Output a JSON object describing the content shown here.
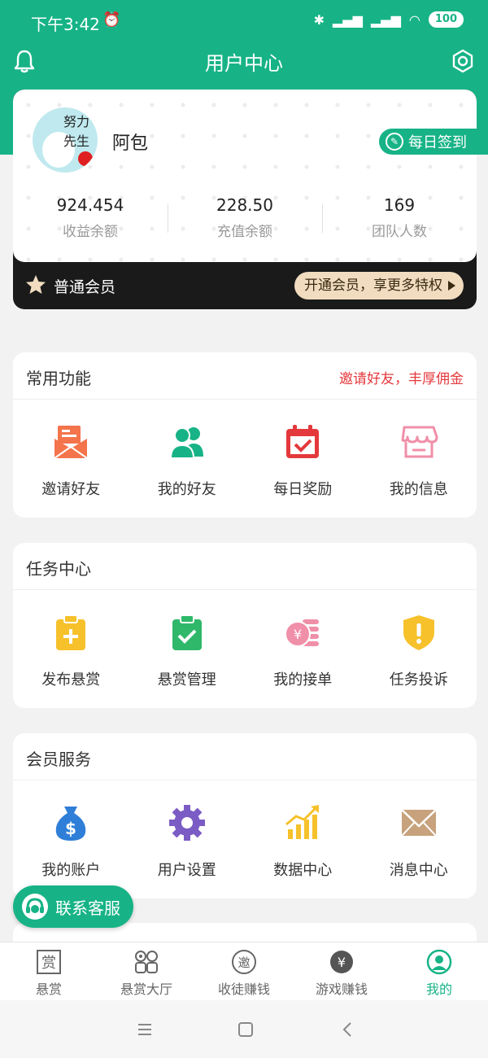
{
  "status": {
    "time": "下午3:42",
    "battery": "100"
  },
  "header": {
    "title": "用户中心"
  },
  "profile": {
    "name": "阿包",
    "avatar_text": "努力先生",
    "checkin_label": "每日签到",
    "stats": [
      {
        "value": "924.454",
        "label": "收益余额"
      },
      {
        "value": "228.50",
        "label": "充值余额"
      },
      {
        "value": "169",
        "label": "团队人数"
      }
    ],
    "member_level": "普通会员",
    "upgrade_label": "开通会员，享更多特权"
  },
  "common": {
    "title": "常用功能",
    "link": "邀请好友，丰厚佣金",
    "items": [
      {
        "label": "邀请好友",
        "icon": "invite-envelope-icon",
        "color": "#f4744b"
      },
      {
        "label": "我的好友",
        "icon": "friends-icon",
        "color": "#17b386"
      },
      {
        "label": "每日奖励",
        "icon": "calendar-check-icon",
        "color": "#e4393c"
      },
      {
        "label": "我的信息",
        "icon": "store-icon",
        "color": "#f08fa8"
      }
    ]
  },
  "tasks": {
    "title": "任务中心",
    "items": [
      {
        "label": "发布悬赏",
        "icon": "clipboard-plus-icon",
        "color": "#f6c12b"
      },
      {
        "label": "悬赏管理",
        "icon": "clipboard-check-icon",
        "color": "#2fb86a"
      },
      {
        "label": "我的接单",
        "icon": "coins-icon",
        "color": "#f08fa8"
      },
      {
        "label": "任务投诉",
        "icon": "shield-alert-icon",
        "color": "#f6c12b"
      }
    ]
  },
  "member_services": {
    "title": "会员服务",
    "items": [
      {
        "label": "我的账户",
        "icon": "money-bag-icon",
        "color": "#2f7ed8"
      },
      {
        "label": "用户设置",
        "icon": "gear-icon",
        "color": "#7b5cc4"
      },
      {
        "label": "数据中心",
        "icon": "bar-chart-icon",
        "color": "#f6c12b"
      },
      {
        "label": "消息中心",
        "icon": "mail-icon",
        "color": "#c7a27c"
      }
    ]
  },
  "kefu_label": "联系客服",
  "tabs": [
    {
      "label": "悬赏",
      "glyph": "赏",
      "icon": "reward-icon"
    },
    {
      "label": "悬赏大厅",
      "glyph": "",
      "icon": "grid-icon"
    },
    {
      "label": "收徒赚钱",
      "glyph": "邀",
      "icon": "invite-icon"
    },
    {
      "label": "游戏赚钱",
      "glyph": "¥",
      "icon": "yuan-icon"
    },
    {
      "label": "我的",
      "glyph": "",
      "icon": "user-icon"
    }
  ],
  "active_tab": 4
}
